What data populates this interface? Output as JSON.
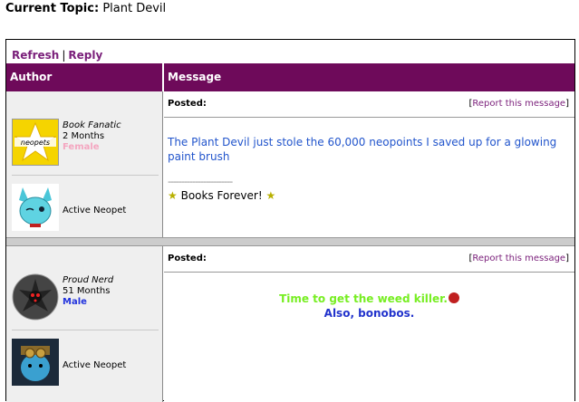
{
  "topic": {
    "label": "Current Topic:",
    "name": "Plant Devil"
  },
  "toolbar": {
    "refresh": "Refresh",
    "sep": "|",
    "reply": "Reply"
  },
  "headers": {
    "author": "Author",
    "message": "Message"
  },
  "posts": [
    {
      "user": {
        "title": "Book Fanatic",
        "tenure": "2 Months",
        "gender": "Female",
        "avatar_icon": "neopets-star-avatar",
        "pet_label": "Active Neopet",
        "pet_icon": "blue-pet-icon"
      },
      "posted_label": "Posted:",
      "report": {
        "open": "[",
        "link": "Report this message",
        "close": "]"
      },
      "message": "The Plant Devil just stole the 60,000 neopoints I saved up for a glowing paint brush",
      "sig_line": "------------------------",
      "signature": "Books Forever!",
      "message_color": "#2255cc"
    },
    {
      "user": {
        "title": "Proud Nerd",
        "tenure": "51 Months",
        "gender": "Male",
        "avatar_icon": "dark-flower-avatar",
        "pet_label": "Active Neopet",
        "pet_icon": "steampunk-pet-icon"
      },
      "posted_label": "Posted:",
      "report": {
        "open": "[",
        "link": "Report this message",
        "close": "]"
      },
      "message_line1": "Time to get the weed killer.",
      "message_line2": "Also, bonobos.",
      "line1_color": "#77ee22",
      "line2_color": "#2233cc"
    }
  ]
}
